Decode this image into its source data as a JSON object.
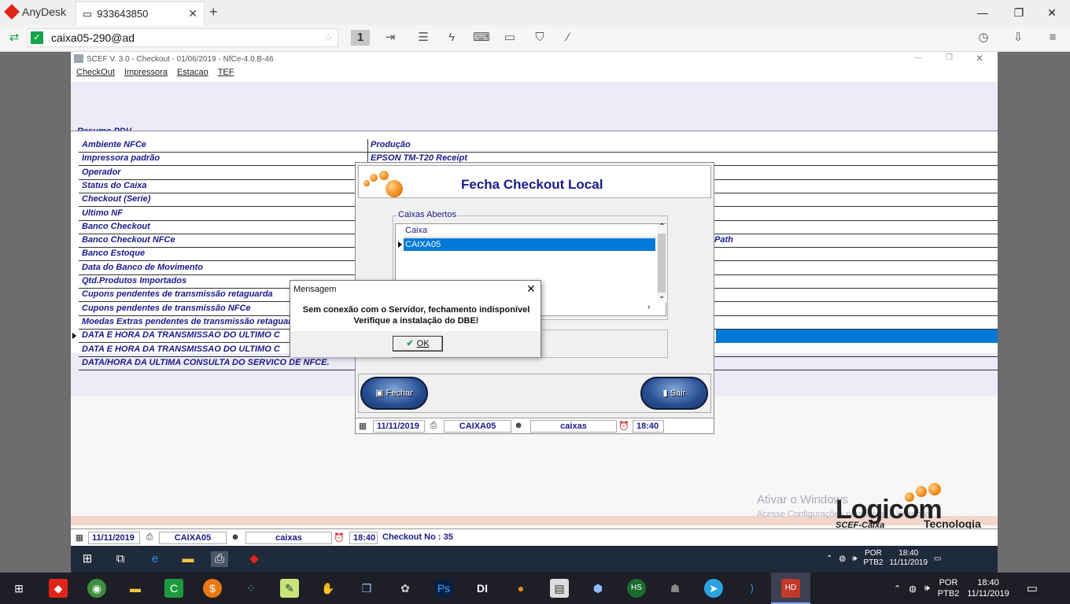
{
  "anydesk": {
    "app_name": "AnyDesk",
    "tab_label": "933643850",
    "address": "caixa05-290@ad",
    "badge_number": "1",
    "icons": [
      "chat-icon",
      "lightning-icon",
      "keyboard-icon",
      "monitor-icon",
      "shield-icon",
      "pen-icon",
      "history-icon",
      "download-icon",
      "menu-icon"
    ]
  },
  "scef": {
    "window_title": "SCEF V.  3.0 - Checkout - 01/06/2019 - NfCe-4.0.B-46",
    "menu": [
      "CheckOut",
      "Impressora",
      "Estacao",
      "TEF"
    ],
    "resumo_label": "Resumo PDV",
    "rows": [
      {
        "label": "Ambiente NFCe",
        "value": "Produção"
      },
      {
        "label": "Impressora padrão",
        "value": "EPSON TM-T20 Receipt"
      },
      {
        "label": "Operador",
        "value": ""
      },
      {
        "label": "Status do Caixa",
        "value": ""
      },
      {
        "label": "Checkout (Serie)",
        "value": ""
      },
      {
        "label": "Ultimo NF",
        "value": ""
      },
      {
        "label": "Banco Checkout",
        "value": ""
      },
      {
        "label": "Banco Checkout NFCe",
        "value": "Path"
      },
      {
        "label": "Banco Estoque",
        "value": ""
      },
      {
        "label": "Data do Banco de Movimento",
        "value": ""
      },
      {
        "label": "Qtd.Produtos Importados",
        "value": ""
      },
      {
        "label": "Cupons pendentes de transmissão retaguarda",
        "value": ""
      },
      {
        "label": "Cupons pendentes de transmissão NFCe",
        "value": ""
      },
      {
        "label": "Moedas Extras pendentes de transmissão retaguar",
        "value": ""
      },
      {
        "label": "DATA E HORA DA TRANSMISSAO DO ULTIMO C",
        "value": ""
      },
      {
        "label": "DATA E HORA DA TRANSMISSAO DO ULTIMO C",
        "value": ""
      },
      {
        "label": "DATA/HORA DA ULTIMA CONSULTA DO SERVICO DE NFCE.",
        "value": ""
      }
    ],
    "statusbar": {
      "date": "11/11/2019",
      "caixa": "CAIXA05",
      "user": "caixas",
      "time": "18:40",
      "checkout": "Checkout No : 35"
    },
    "watermark_title": "Ativar o Windows",
    "watermark_sub": "Acesse Configurações para ativar o Windows.",
    "brand": "Logicom",
    "brand_sub1": "SCEF-Caixa",
    "brand_sub2": "Tecnologia"
  },
  "fecha": {
    "title": "Fecha Checkout Local",
    "group_label": "Caixas Abertos",
    "list_header": "Caixa",
    "list_selected": "CAIXA05",
    "btn_fechar": "Fechar",
    "btn_sair": "Sair",
    "statusbar": {
      "date": "11/11/2019",
      "caixa": "CAIXA05",
      "user": "caixas",
      "time": "18:40"
    }
  },
  "mensagem": {
    "title": "Mensagem",
    "line1": "Sem conexão com o Servidor, fechamento indisponível",
    "line2": "Verifique a instalação do DBE!",
    "ok": "OK"
  },
  "remote_tray": {
    "lang": "POR",
    "layout": "PTB2",
    "time": "18:40",
    "date": "11/11/2019",
    "notif": "3"
  },
  "local_tray": {
    "lang": "POR",
    "layout": "PTB2",
    "time": "18:40",
    "date": "11/11/2019",
    "notif": "1"
  }
}
